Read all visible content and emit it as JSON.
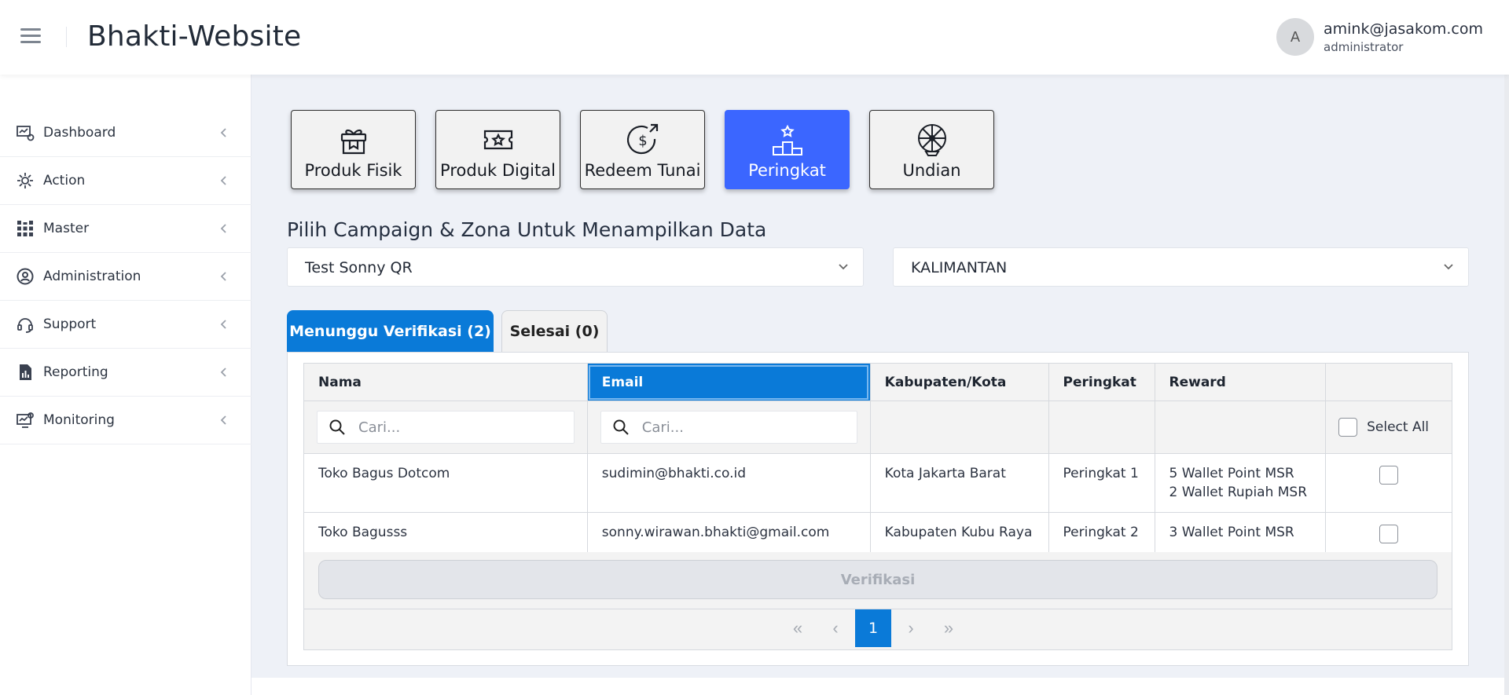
{
  "header": {
    "app_title": "Bhakti-Website",
    "avatar_letter": "A",
    "user_email": "amink@jasakom.com",
    "user_role": "administrator"
  },
  "sidebar": {
    "items": [
      {
        "label": "Dashboard",
        "icon": "dashboard-icon"
      },
      {
        "label": "Action",
        "icon": "action-icon"
      },
      {
        "label": "Master",
        "icon": "master-icon"
      },
      {
        "label": "Administration",
        "icon": "administration-icon"
      },
      {
        "label": "Support",
        "icon": "support-icon"
      },
      {
        "label": "Reporting",
        "icon": "reporting-icon"
      },
      {
        "label": "Monitoring",
        "icon": "monitoring-icon"
      }
    ]
  },
  "categories": [
    {
      "label": "Produk Fisik",
      "icon": "gift-box-icon"
    },
    {
      "label": "Produk Digital",
      "icon": "voucher-icon"
    },
    {
      "label": "Redeem Tunai",
      "icon": "cash-redeem-icon"
    },
    {
      "label": "Peringkat",
      "icon": "podium-icon",
      "active": true
    },
    {
      "label": "Undian",
      "icon": "lottery-wheel-icon"
    }
  ],
  "filter": {
    "title": "Pilih Campaign & Zona Untuk Menampilkan Data",
    "campaign": "Test Sonny QR",
    "zone": "KALIMANTAN"
  },
  "tabs": {
    "pending": "Menunggu Verifikasi (2)",
    "done": "Selesai (0)"
  },
  "table": {
    "columns": [
      "Nama",
      "Email",
      "Kabupaten/Kota",
      "Peringkat",
      "Reward",
      ""
    ],
    "search_placeholder": "Cari...",
    "select_all": "Select All",
    "rows": [
      {
        "nama": "Toko Bagus Dotcom",
        "email": "sudimin@bhakti.co.id",
        "kota": "Kota Jakarta Barat",
        "peringkat": "Peringkat 1",
        "reward_1": "5 Wallet Point MSR",
        "reward_2": "2 Wallet Rupiah MSR"
      },
      {
        "nama": "Toko Bagusss",
        "email": "sonny.wirawan.bhakti@gmail.com",
        "kota": "Kabupaten Kubu Raya",
        "peringkat": "Peringkat 2",
        "reward_1": "3 Wallet Point MSR",
        "reward_2": ""
      }
    ]
  },
  "actions": {
    "verify": "Verifikasi"
  },
  "pagination": {
    "current_page": "1",
    "first": "«",
    "prev": "‹",
    "next": "›",
    "last": "»"
  },
  "colors": {
    "accent": "#0a7ad8",
    "active_category": "#3b66ff",
    "background": "#eef1f7"
  }
}
